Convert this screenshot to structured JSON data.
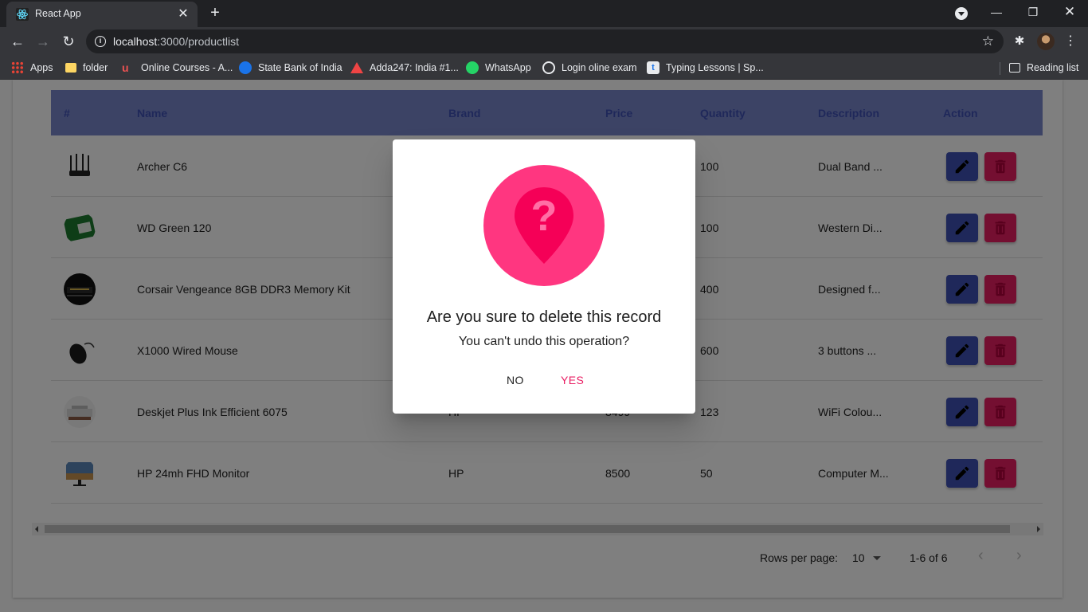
{
  "browser": {
    "tab_title": "React App",
    "url_host": "localhost",
    "url_rest": ":3000/productlist",
    "bookmarks": [
      {
        "label": "Apps",
        "icon": "apps-grid-icon"
      },
      {
        "label": "folder",
        "icon": "folder-icon"
      },
      {
        "label": "Online Courses - A...",
        "icon": "udemy-icon"
      },
      {
        "label": "State Bank of India",
        "icon": "sbi-icon"
      },
      {
        "label": "Adda247: India #1...",
        "icon": "adda247-icon"
      },
      {
        "label": "WhatsApp",
        "icon": "whatsapp-icon"
      },
      {
        "label": "Login oline exam",
        "icon": "globe-icon"
      },
      {
        "label": "Typing Lessons | Sp...",
        "icon": "typing-icon"
      }
    ],
    "reading_list": "Reading list"
  },
  "table": {
    "headers": [
      "#",
      "Name",
      "Brand",
      "Price",
      "Quantity",
      "Description",
      "Action"
    ],
    "rows": [
      {
        "name": "Archer C6",
        "brand": "",
        "price": "",
        "quantity": "100",
        "description": "Dual Band ...",
        "image": "router"
      },
      {
        "name": "WD Green 120",
        "brand": "",
        "price": "",
        "quantity": "100",
        "description": "Western Di...",
        "image": "ssd"
      },
      {
        "name": "Corsair Vengeance 8GB DDR3 Memory Kit",
        "brand": "",
        "price": "",
        "quantity": "400",
        "description": "Designed f...",
        "image": "ram"
      },
      {
        "name": "X1000 Wired Mouse",
        "brand": "",
        "price": "",
        "quantity": "600",
        "description": "3 buttons ...",
        "image": "mouse"
      },
      {
        "name": "Deskjet Plus Ink Efficient 6075",
        "brand": "HP",
        "price": "8499",
        "quantity": "123",
        "description": "WiFi Colou...",
        "image": "printer"
      },
      {
        "name": "HP 24mh FHD Monitor",
        "brand": "HP",
        "price": "8500",
        "quantity": "50",
        "description": "Computer M...",
        "image": "monitor"
      }
    ]
  },
  "pagination": {
    "rows_per_page_label": "Rows per page:",
    "rows_per_page_value": "10",
    "range": "1-6 of 6"
  },
  "dialog": {
    "title": "Are you sure to delete this record",
    "subtitle": "You can't undo this operation?",
    "no_label": "NO",
    "yes_label": "YES",
    "icon": "question-pin-icon"
  },
  "colors": {
    "primary": "#3f51b5",
    "secondary": "#e91e63",
    "dialog_icon_bg": "#ff3680"
  }
}
